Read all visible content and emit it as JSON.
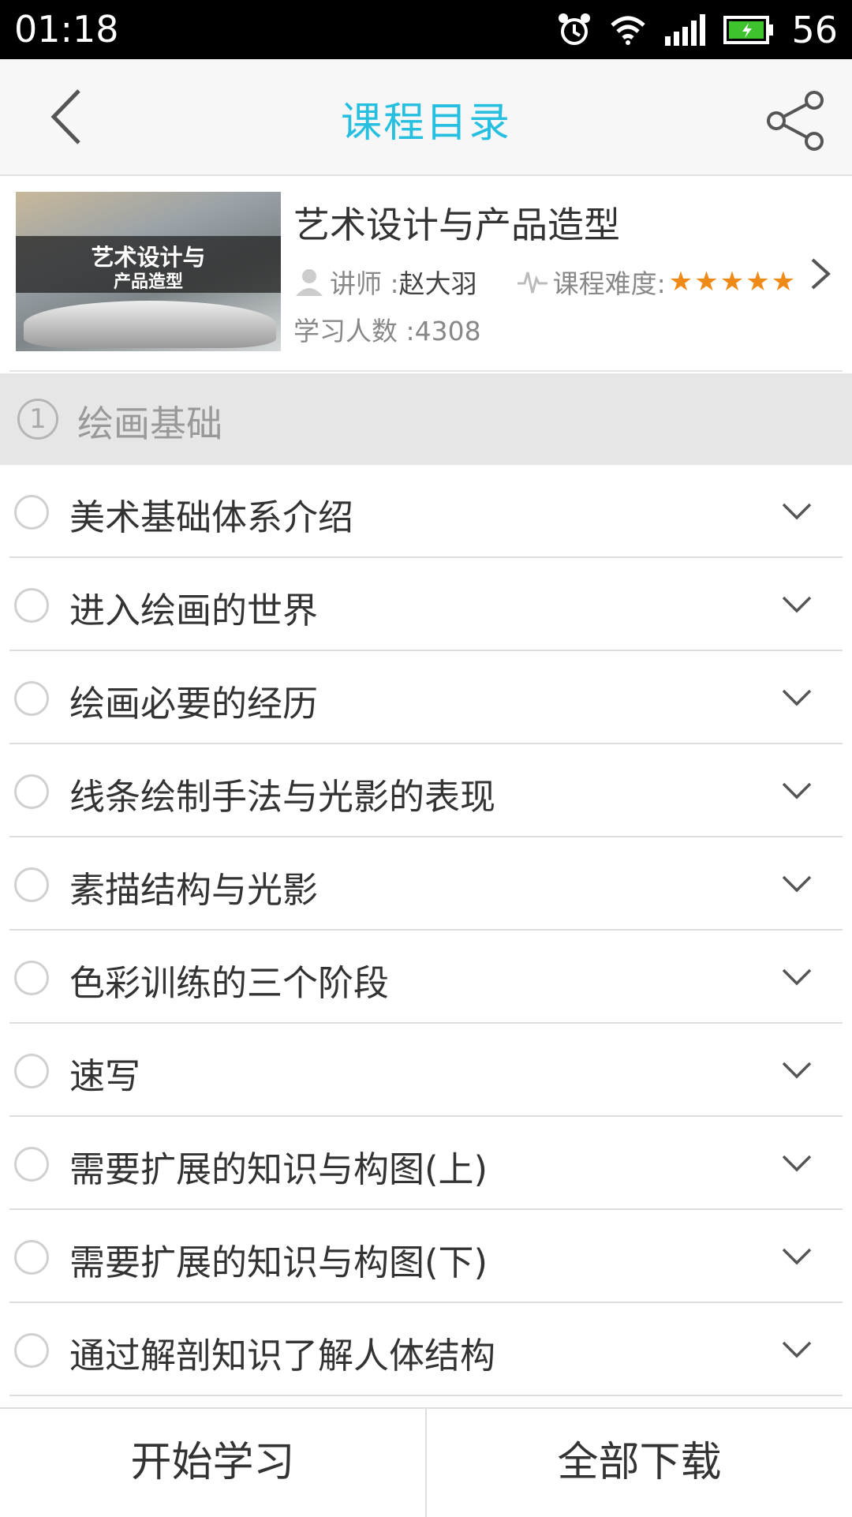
{
  "status": {
    "time": "01:18",
    "battery_level": "56",
    "icons": [
      "alarm-icon",
      "wifi-icon",
      "signal-icon",
      "battery-charging-icon"
    ]
  },
  "header": {
    "title": "课程目录",
    "back_icon": "back-arrow-icon",
    "share_icon": "share-icon"
  },
  "course": {
    "thumbnail_line1": "艺术设计与",
    "thumbnail_line2": "产品造型",
    "name": "艺术设计与产品造型",
    "teacher_label": "讲师 : ",
    "teacher_name": "赵大羽",
    "difficulty_label": "课程难度:",
    "difficulty_stars": 5,
    "learners": "学习人数 :4308"
  },
  "section": {
    "number": "1",
    "title": "绘画基础"
  },
  "lessons": [
    {
      "title": "美术基础体系介绍"
    },
    {
      "title": "进入绘画的世界"
    },
    {
      "title": "绘画必要的经历"
    },
    {
      "title": "线条绘制手法与光影的表现"
    },
    {
      "title": "素描结构与光影"
    },
    {
      "title": "色彩训练的三个阶段"
    },
    {
      "title": "速写"
    },
    {
      "title": "需要扩展的知识与构图(上)"
    },
    {
      "title": "需要扩展的知识与构图(下)"
    },
    {
      "title": "通过解剖知识了解人体结构"
    }
  ],
  "bottom": {
    "start_label": "开始学习",
    "download_label": "全部下载"
  },
  "colors": {
    "accent": "#27bfe0",
    "star": "#f08a17",
    "section_bg": "#e6e6e6"
  }
}
